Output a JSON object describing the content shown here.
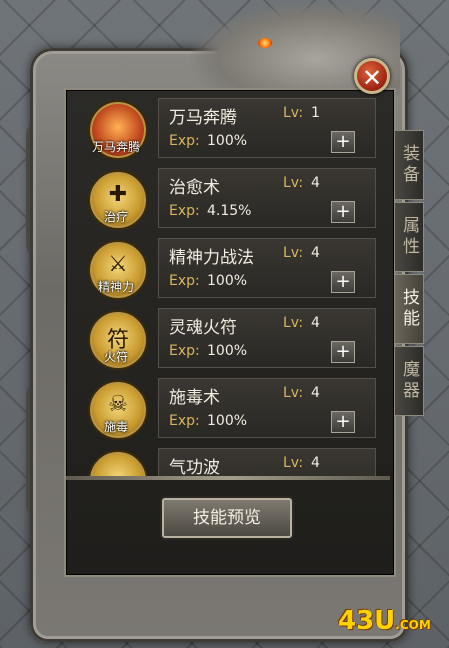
{
  "window": {
    "close_symbol": "✕"
  },
  "skills": [
    {
      "icon_label": "万马奔腾",
      "icon": "horse-warrior-icon",
      "glyph": "",
      "name": "万马奔腾",
      "lv_label": "Lv:",
      "lv": "1",
      "exp_label": "Exp:",
      "exp": "100%",
      "plus": "+"
    },
    {
      "icon_label": "治疗",
      "icon": "heal-icon",
      "glyph": "✚",
      "name": "治愈术",
      "lv_label": "Lv:",
      "lv": "4",
      "exp_label": "Exp:",
      "exp": "4.15%",
      "plus": "+"
    },
    {
      "icon_label": "精神力",
      "icon": "sword-spirit-icon",
      "glyph": "⚔",
      "name": "精神力战法",
      "lv_label": "Lv:",
      "lv": "4",
      "exp_label": "Exp:",
      "exp": "100%",
      "plus": "+"
    },
    {
      "icon_label": "火符",
      "icon": "fire-talisman-icon",
      "glyph": "符",
      "name": "灵魂火符",
      "lv_label": "Lv:",
      "lv": "4",
      "exp_label": "Exp:",
      "exp": "100%",
      "plus": "+"
    },
    {
      "icon_label": "施毒",
      "icon": "poison-icon",
      "glyph": "☠",
      "name": "施毒术",
      "lv_label": "Lv:",
      "lv": "4",
      "exp_label": "Exp:",
      "exp": "100%",
      "plus": "+"
    },
    {
      "icon_label": "",
      "icon": "shockwave-icon",
      "glyph": "",
      "name": "气功波",
      "lv_label": "Lv:",
      "lv": "4",
      "exp_label": "",
      "exp": "",
      "plus": ""
    }
  ],
  "preview_button": "技能预览",
  "tabs": [
    {
      "label": "装备",
      "active": false
    },
    {
      "label": "属性",
      "active": false
    },
    {
      "label": "技能",
      "active": true
    },
    {
      "label": "魔器",
      "active": false
    }
  ],
  "watermark": {
    "main": "43U",
    "suffix": ".COM"
  },
  "colors": {
    "accent_gold": "#d8b560",
    "close_red": "#c0391b",
    "watermark_yellow": "#ffd200"
  }
}
